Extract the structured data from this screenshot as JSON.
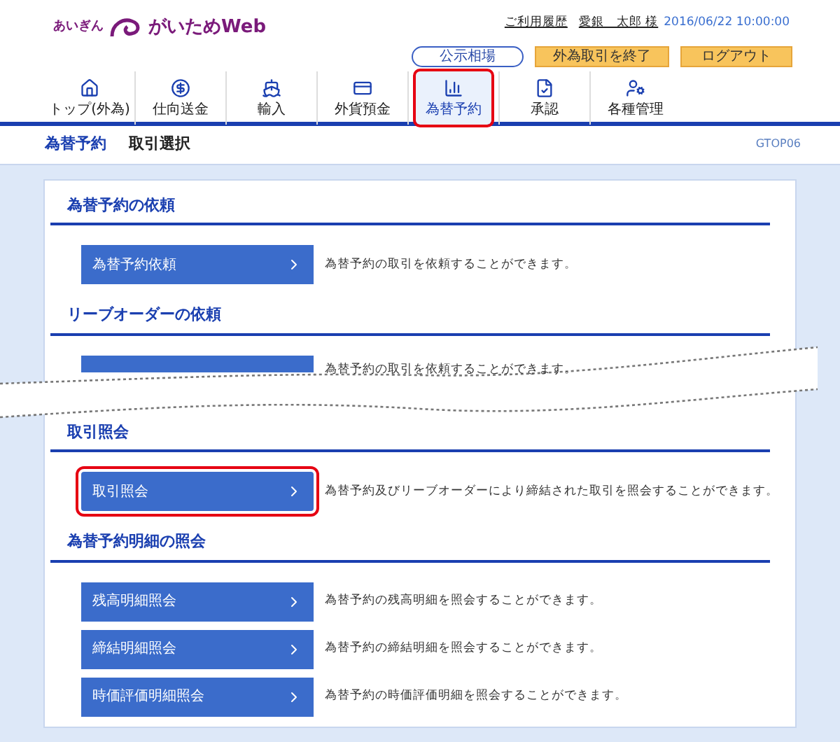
{
  "header": {
    "bank": "あいぎん",
    "brand": "がいためWeb",
    "history_link": "ご利用履歴",
    "user": "愛銀　太郎 様",
    "datetime": "2016/06/22 10:00:00",
    "buttons": [
      {
        "label": "公示相場",
        "kind": "outline"
      },
      {
        "label": "外為取引を終了",
        "kind": "warning"
      },
      {
        "label": "ログアウト",
        "kind": "warning"
      }
    ]
  },
  "tabs": [
    {
      "label": "トップ(外為)",
      "selected": false,
      "highlighted": false
    },
    {
      "label": "仕向送金",
      "selected": false,
      "highlighted": false
    },
    {
      "label": "輸入",
      "selected": false,
      "highlighted": false
    },
    {
      "label": "外貨預金",
      "selected": false,
      "highlighted": false
    },
    {
      "label": "為替予約",
      "selected": true,
      "highlighted": true
    },
    {
      "label": "承認",
      "selected": false,
      "highlighted": false
    },
    {
      "label": "各種管理",
      "selected": false,
      "highlighted": false
    }
  ],
  "breadcrumb": {
    "section": "為替予約",
    "page": "取引選択",
    "screen_id": "GTOP06"
  },
  "sections": [
    {
      "title": "為替予約の依頼",
      "items": [
        {
          "label": "為替予約依頼",
          "description": "為替予約の取引を依頼することができます。",
          "highlighted": false
        }
      ]
    },
    {
      "title": "リーブオーダーの依頼",
      "items": [
        {
          "description": "為替予約の取引を依頼することができます。",
          "highlighted": false
        }
      ],
      "torn": true
    },
    {
      "title": "取引照会",
      "items": [
        {
          "label": "取引照会",
          "description": "為替予約及びリーブオーダーにより締結された取引を照会することができます。",
          "highlighted": true
        }
      ]
    },
    {
      "title": "為替予約明細の照会",
      "items": [
        {
          "label": "残高明細照会",
          "description": "為替予約の残高明細を照会することができます。",
          "highlighted": false
        },
        {
          "label": "締結明細照会",
          "description": "為替予約の締結明細を照会することができます。",
          "highlighted": false
        },
        {
          "label": "時価評価明細照会",
          "description": "為替予約の時価評価明細を照会することができます。",
          "highlighted": false
        }
      ]
    }
  ]
}
